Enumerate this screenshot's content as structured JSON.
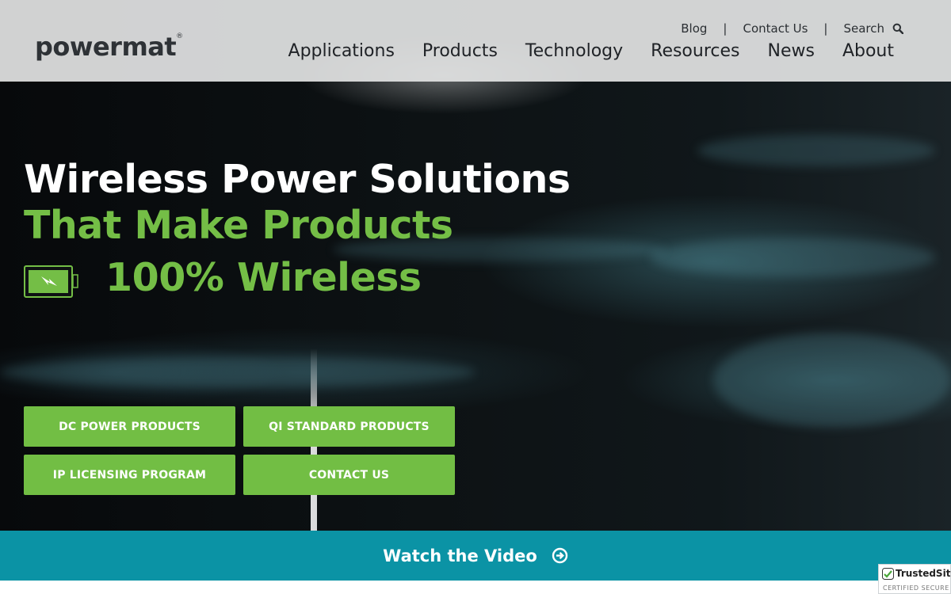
{
  "header": {
    "logo_text": "powermat",
    "logo_mark": "®",
    "top_links": [
      "Blog",
      "Contact Us",
      "Search"
    ],
    "separator": "|",
    "nav": [
      "Applications",
      "Products",
      "Technology",
      "Resources",
      "News",
      "About"
    ]
  },
  "hero": {
    "line1": "Wireless Power Solutions",
    "line2": "That Make Products",
    "line3": "100% Wireless",
    "buttons": [
      "DC POWER PRODUCTS",
      "QI STANDARD PRODUCTS",
      "IP LICENSING PROGRAM",
      "CONTACT US"
    ]
  },
  "video_bar": {
    "label": "Watch the Video"
  },
  "badge": {
    "title": "TrustedSite",
    "subtitle": "CERTIFIED SECURE"
  },
  "colors": {
    "accent": "#72be44",
    "video_bar": "#0b93a5",
    "header_bg": "#e1e2e2"
  },
  "icons": [
    "search-icon",
    "battery-icon",
    "arrow-circle-right-icon",
    "check-icon"
  ]
}
